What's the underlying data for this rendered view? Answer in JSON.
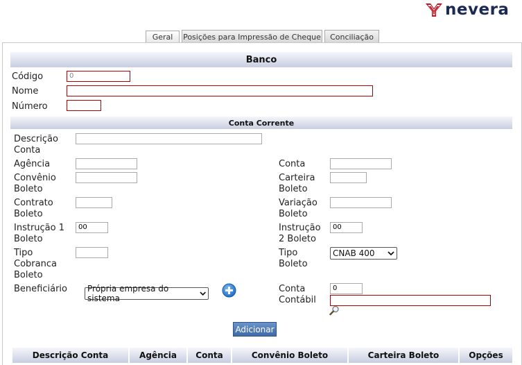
{
  "brand": {
    "name": "nevera",
    "color": "#1a2a54",
    "accent": "#c1121f"
  },
  "tabs": [
    {
      "label": "Geral",
      "active": true
    },
    {
      "label": "Posições para Impressão de Cheque",
      "active": false
    },
    {
      "label": "Conciliação",
      "active": false
    }
  ],
  "banco": {
    "title": "Banco",
    "codigo_label": "Código",
    "codigo_value": "0",
    "nome_label": "Nome",
    "nome_value": "",
    "numero_label": "Número",
    "numero_value": ""
  },
  "conta_corrente": {
    "title": "Conta Corrente",
    "descricao_label_1": "Descrição",
    "descricao_label_2": "Conta",
    "agencia_label": "Agência",
    "conta_label": "Conta",
    "convenio_label_1": "Convênio",
    "convenio_label_2": "Boleto",
    "carteira_label_1": "Carteira",
    "carteira_label_2": "Boleto",
    "contrato_label_1": "Contrato",
    "contrato_label_2": "Boleto",
    "variacao_label_1": "Variação",
    "variacao_label_2": "Boleto",
    "instrucao1_label_1": "Instrução 1",
    "instrucao1_label_2": "Boleto",
    "instrucao1_value": "00",
    "instrucao2_label_1": "Instrução",
    "instrucao2_label_2": "2 Boleto",
    "instrucao2_value": "00",
    "tipo_cobranca_label_1": "Tipo",
    "tipo_cobranca_label_2": "Cobranca",
    "tipo_cobranca_label_3": "Boleto",
    "tipo_boleto_label_1": "Tipo",
    "tipo_boleto_label_2": "Boleto",
    "tipo_boleto_selected": "CNAB 400",
    "beneficiario_label": "Beneficiário",
    "beneficiario_selected": "Própria empresa do sistema",
    "conta_contabil_label_1": "Conta",
    "conta_contabil_label_2": "Contábil",
    "conta_contabil_value": "0",
    "add_button": "Adicionar"
  },
  "table": {
    "columns": [
      "Descrição Conta",
      "Agência",
      "Conta",
      "Convênio Boleto",
      "Carteira Boleto",
      "Opções"
    ]
  },
  "icons": {
    "add": "plus-circle-icon",
    "search": "magnifier-icon"
  }
}
